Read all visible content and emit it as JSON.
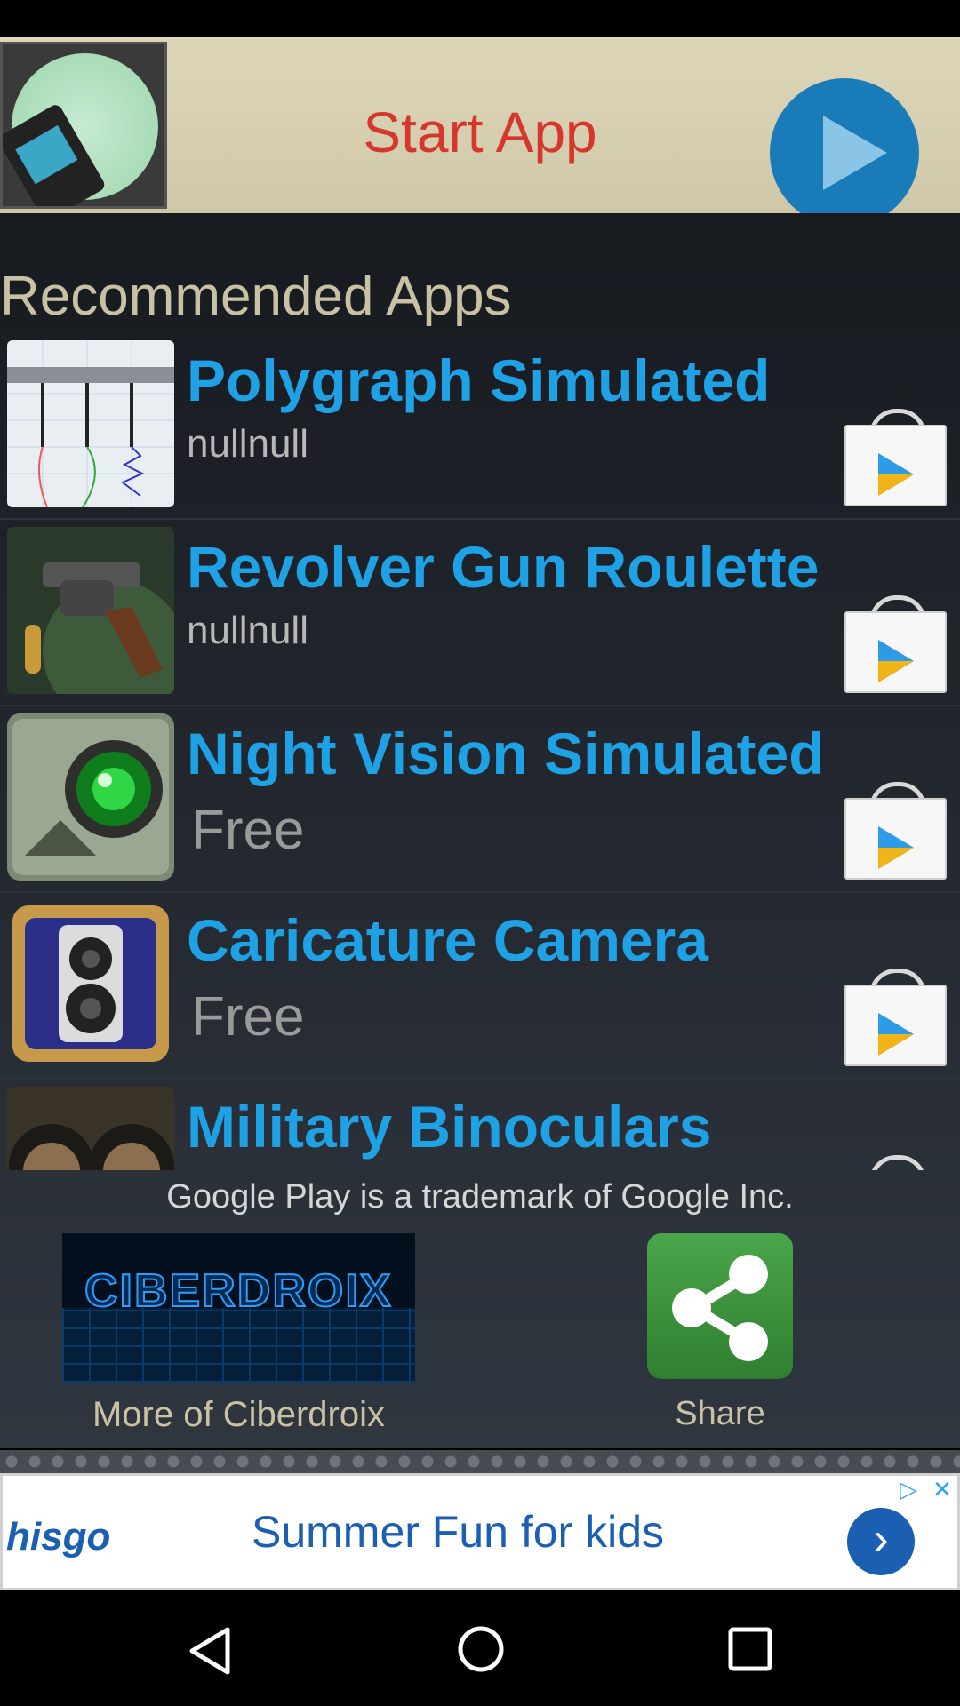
{
  "banner": {
    "title": "Start App"
  },
  "section": {
    "title": "Recommended Apps"
  },
  "apps": [
    {
      "name": "Polygraph Simulated",
      "price": "nullnull"
    },
    {
      "name": "Revolver Gun Roulette",
      "price": "nullnull"
    },
    {
      "name": "Night Vision Simulated",
      "price": "Free"
    },
    {
      "name": "Caricature Camera",
      "price": "Free"
    },
    {
      "name": "Military Binoculars",
      "price": ""
    }
  ],
  "footer": {
    "trademark": "Google Play is a trademark of Google Inc.",
    "more_label": "More of Ciberdroix",
    "more_logo": "CIBERDROIX",
    "share_label": "Share"
  },
  "ad": {
    "brand": "hisgo",
    "text": "Summer Fun for kids"
  },
  "colors": {
    "accent_blue": "#1fa1e6",
    "start_red": "#d6362b",
    "share_green": "#3f9a3f"
  }
}
